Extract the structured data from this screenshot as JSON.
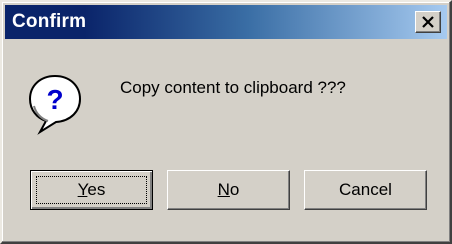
{
  "window": {
    "title": "Confirm",
    "close_glyph": "✕"
  },
  "message": {
    "icon": "question-icon",
    "icon_glyph": "?",
    "text": "Copy content to clipboard ???"
  },
  "buttons": [
    {
      "label": "Yes",
      "mnemonic": "Y",
      "rest": "es",
      "default": true
    },
    {
      "label": "No",
      "mnemonic": "N",
      "rest": "o",
      "default": false
    },
    {
      "label": "Cancel",
      "mnemonic": "",
      "rest": "Cancel",
      "default": false
    }
  ],
  "colors": {
    "face": "#d4d0c8",
    "title_start": "#0a246a",
    "title_end": "#a6caf0",
    "icon_blue": "#0000cc"
  }
}
